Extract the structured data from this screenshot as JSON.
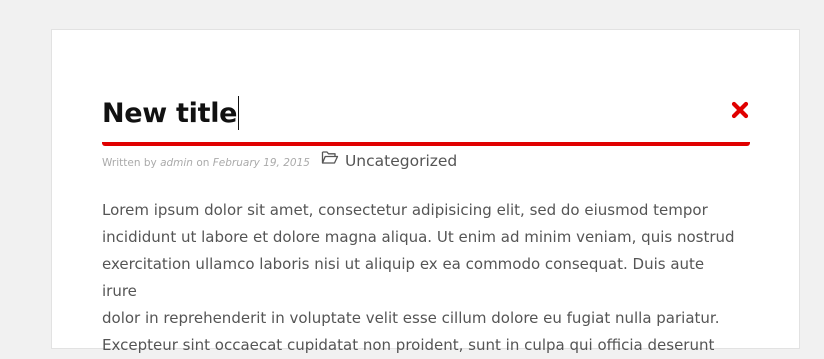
{
  "post": {
    "title": "New title",
    "meta": {
      "written_by": "Written by",
      "author": "admin",
      "on": "on",
      "date": "February 19, 2015",
      "category": "Uncategorized"
    },
    "body": {
      "line1": "Lorem ipsum dolor sit amet, consectetur adipisicing elit, sed do eiusmod tempor",
      "line2": "incididunt ut labore et dolore magna aliqua. Ut enim ad minim veniam, quis nostrud",
      "line3": "exercitation ullamco laboris nisi ut aliquip ex ea commodo consequat. Duis aute irure",
      "line4": "dolor in reprehenderit in voluptate velit esse cillum dolore eu fugiat nulla pariatur.",
      "line5": "Excepteur sint occaecat cupidatat non proident, sunt in culpa qui officia deserunt"
    }
  },
  "icons": {
    "close": "close-icon",
    "folder": "folder-open-icon"
  },
  "colors": {
    "accent": "#e00000",
    "title": "#111111",
    "body": "#555555",
    "meta": "#aaaaaa"
  }
}
